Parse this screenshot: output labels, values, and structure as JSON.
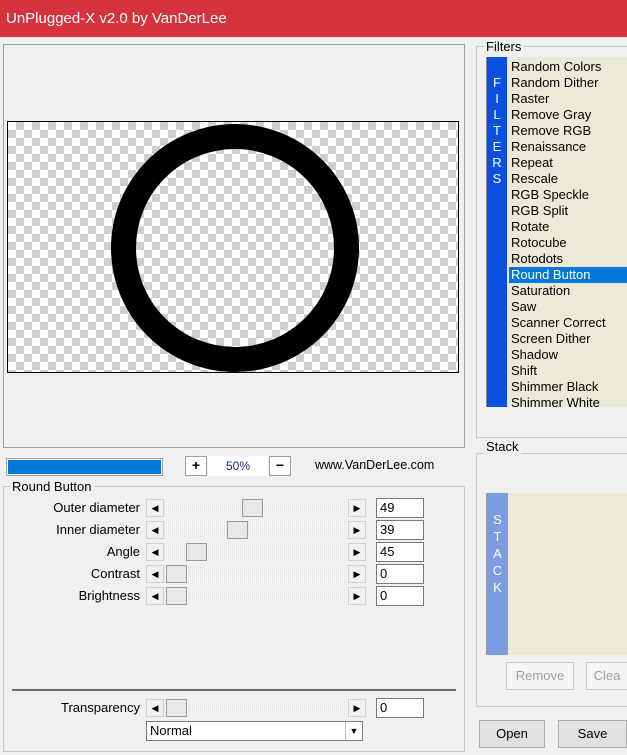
{
  "window": {
    "title": "UnPlugged-X v2.0 by VanDerLee"
  },
  "preview": {
    "progress_percent": 100,
    "zoom_in_label": "+",
    "zoom_out_label": "−",
    "zoom_value": "50%",
    "website": "www.VanDerLee.com"
  },
  "params": {
    "group_title": "Round Button",
    "sliders": [
      {
        "label": "Outer diameter",
        "value": "49"
      },
      {
        "label": "Inner diameter",
        "value": "39"
      },
      {
        "label": "Angle",
        "value": "45"
      },
      {
        "label": "Contrast",
        "value": "0"
      },
      {
        "label": "Brightness",
        "value": "0"
      }
    ],
    "transparency": {
      "label": "Transparency",
      "value": "0"
    },
    "blend_mode": "Normal"
  },
  "filters": {
    "group_title": "Filters",
    "tab_label": "FILTERS",
    "items": [
      "Random Colors",
      "Random Dither",
      "Raster",
      "Remove Gray",
      "Remove RGB",
      "Renaissance",
      "Repeat",
      "Rescale",
      "RGB Speckle",
      "RGB Split",
      "Rotate",
      "Rotocube",
      "Rotodots",
      "Round Button",
      "Saturation",
      "Saw",
      "Scanner Correct",
      "Screen Dither",
      "Shadow",
      "Shift",
      "Shimmer Black",
      "Shimmer White"
    ],
    "selected": "Round Button"
  },
  "stack": {
    "group_title": "Stack",
    "tab_label": "STACK",
    "remove_label": "Remove",
    "clear_label": "Clea"
  },
  "actions": {
    "open_label": "Open",
    "save_label": "Save"
  }
}
